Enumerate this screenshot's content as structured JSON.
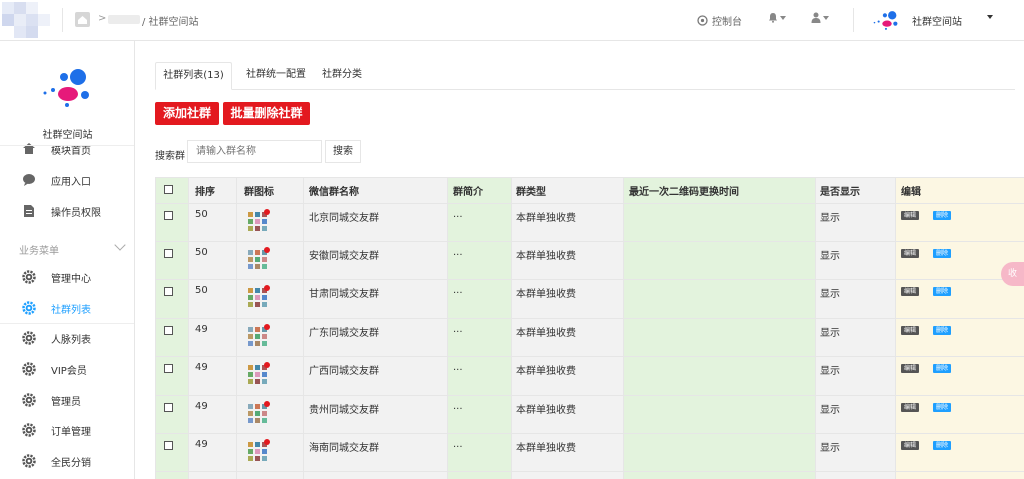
{
  "topbar": {
    "breadcrumb_current": "/ 社群空间站",
    "console_label": "控制台",
    "brand_name": "社群空间站"
  },
  "sidebar": {
    "brand_name": "社群空间站",
    "items_top": [
      {
        "label": "模块首页",
        "icon": "home-icon"
      },
      {
        "label": "应用入口",
        "icon": "chat-icon"
      },
      {
        "label": "操作员权限",
        "icon": "document-icon"
      }
    ],
    "group_label": "业务菜单",
    "items_business": [
      {
        "label": "管理中心",
        "icon": "gear-icon"
      },
      {
        "label": "社群列表",
        "icon": "gear-icon",
        "active": true
      },
      {
        "label": "人脉列表",
        "icon": "gear-icon"
      },
      {
        "label": "VIP会员",
        "icon": "gear-icon"
      },
      {
        "label": "管理员",
        "icon": "gear-icon"
      },
      {
        "label": "订单管理",
        "icon": "gear-icon"
      },
      {
        "label": "全民分销",
        "icon": "gear-icon"
      }
    ]
  },
  "tabs": [
    {
      "label": "社群列表(13)",
      "active": true
    },
    {
      "label": "社群统一配置",
      "active": false
    },
    {
      "label": "社群分类",
      "active": false
    }
  ],
  "actions": {
    "add_label": "添加社群",
    "batch_delete_label": "批量删除社群"
  },
  "search": {
    "label": "搜索群",
    "placeholder": "请输入群名称",
    "button_label": "搜索"
  },
  "table": {
    "headers": [
      "排序",
      "群图标",
      "微信群名称",
      "群简介",
      "群类型",
      "最近一次二维码更换时间",
      "是否显示",
      "编辑"
    ],
    "edit_label": "编辑",
    "delete_label": "删除",
    "rows": [
      {
        "sort": "50",
        "name": "北京同城交友群",
        "intro": "...",
        "type": "本群单独收费",
        "qr_time": "",
        "display": "显示"
      },
      {
        "sort": "50",
        "name": "安徽同城交友群",
        "intro": "...",
        "type": "本群单独收费",
        "qr_time": "",
        "display": "显示"
      },
      {
        "sort": "50",
        "name": "甘肃同城交友群",
        "intro": "...",
        "type": "本群单独收费",
        "qr_time": "",
        "display": "显示"
      },
      {
        "sort": "49",
        "name": "广东同城交友群",
        "intro": "...",
        "type": "本群单独收费",
        "qr_time": "",
        "display": "显示"
      },
      {
        "sort": "49",
        "name": "广西同城交友群",
        "intro": "...",
        "type": "本群单独收费",
        "qr_time": "",
        "display": "显示"
      },
      {
        "sort": "49",
        "name": "贵州同城交友群",
        "intro": "...",
        "type": "本群单独收费",
        "qr_time": "",
        "display": "显示"
      },
      {
        "sort": "49",
        "name": "海南同城交友群",
        "intro": "...",
        "type": "本群单独收费",
        "qr_time": "",
        "display": "显示"
      }
    ]
  },
  "float_tab_label": "收",
  "colors": {
    "accent_blue": "#1e9fff",
    "danger_red": "#e3191f",
    "col_green": "#e3f3dd",
    "col_yellow": "#fcf7e3"
  }
}
